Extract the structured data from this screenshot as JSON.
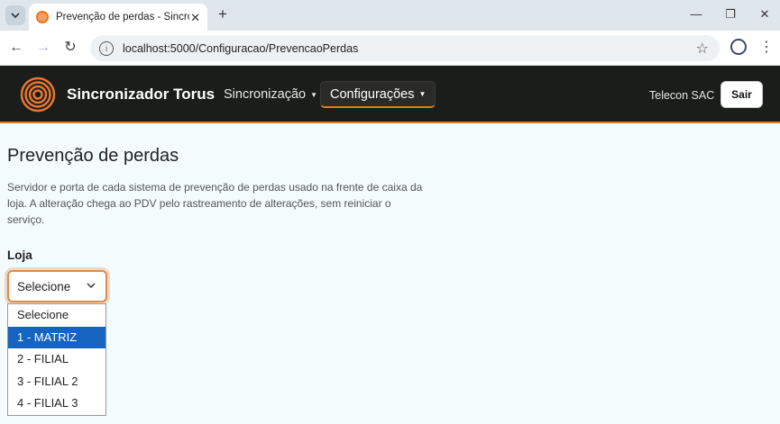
{
  "browser": {
    "tab_title": "Prevenção de perdas - Sincronizador Torus",
    "tab_close": "✕",
    "new_tab": "+",
    "url": "localhost:5000/Configuracao/PrevencaoPerdas"
  },
  "navbar": {
    "brand": "Sincronizador Torus",
    "menu": [
      {
        "label": "Sincronização"
      },
      {
        "label": "Configurações"
      }
    ],
    "user": "Telecon SAC",
    "logout_label": "Sair",
    "accent_color": "#e07a2e"
  },
  "page": {
    "title": "Prevenção de perdas",
    "description": "Servidor e porta de cada sistema de prevenção de perdas usado na frente de caixa da loja. A alteração chega ao PDV pelo rastreamento de alterações, sem reiniciar o serviço.",
    "store_field": {
      "label": "Loja",
      "selected_value": "Selecione",
      "options": [
        "Selecione",
        "1 - MATRIZ",
        "2 - FILIAL",
        "3 - FILIAL 2",
        "4 - FILIAL 3"
      ],
      "highlighted_option": "1 - MATRIZ"
    }
  }
}
